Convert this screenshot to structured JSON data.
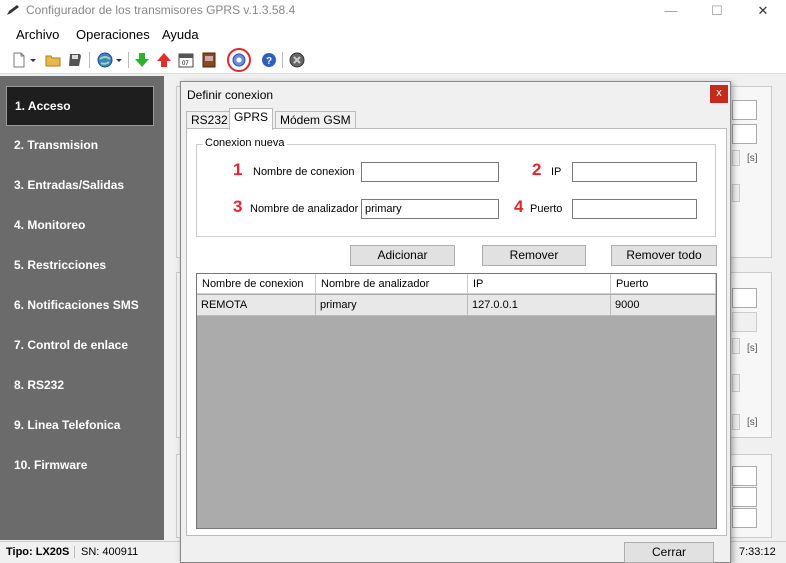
{
  "window": {
    "title": "Configurador de los transmisores GPRS v.1.3.58.4",
    "minimize": "—",
    "maximize": "☐",
    "close": "✕"
  },
  "menu": [
    "Archivo",
    "Operaciones",
    "Ayuda"
  ],
  "toolbar_icons": [
    "new-icon",
    "open-folder-icon",
    "save-icon",
    "connect-globe-icon",
    "download-icon",
    "upload-icon",
    "calendar-icon",
    "book-icon",
    "settings-gear-icon",
    "help-icon",
    "exit-icon"
  ],
  "sidebar": {
    "items": [
      {
        "label": "1. Acceso",
        "active": true
      },
      {
        "label": "2. Transmision"
      },
      {
        "label": "3. Entradas/Salidas"
      },
      {
        "label": "4. Monitoreo"
      },
      {
        "label": "5. Restricciones"
      },
      {
        "label": "6. Notificaciones SMS"
      },
      {
        "label": "7. Control de enlace"
      },
      {
        "label": "8. RS232"
      },
      {
        "label": "9. Linea Telefonica"
      },
      {
        "label": "10. Firmware"
      }
    ]
  },
  "background": {
    "unit1": "[s]",
    "unit2": "[s]",
    "unit3": "[s]"
  },
  "status": {
    "tipo": "Tipo: LX20S",
    "sn": "SN: 400911",
    "time": "7:33:12"
  },
  "dialog": {
    "title": "Definir conexion",
    "close": "x",
    "tabs": [
      "RS232",
      "GPRS",
      "Módem GSM"
    ],
    "active_tab": "GPRS",
    "group_title": "Conexion nueva",
    "fields": {
      "n1": "1",
      "nombre_conexion_label": "Nombre de conexion",
      "nombre_conexion_value": "",
      "n2": "2",
      "ip_label": "IP",
      "ip_value": "",
      "n3": "3",
      "nombre_analizador_label": "Nombre de analizador",
      "nombre_analizador_value": "primary",
      "n4": "4",
      "puerto_label": "Puerto",
      "puerto_value": ""
    },
    "buttons": {
      "add": "Adicionar",
      "remove": "Remover",
      "remove_all": "Remover todo",
      "close": "Cerrar"
    },
    "table": {
      "columns": [
        "Nombre de conexion",
        "Nombre de analizador",
        "IP",
        "Puerto"
      ],
      "rows": [
        [
          "REMOTA",
          "primary",
          "127.0.0.1",
          "9000"
        ]
      ]
    }
  },
  "colors": {
    "sidebar_bg": "#6b6b6b",
    "sidebar_active": "#1e1e1e",
    "dialog_close": "#c42b1c",
    "number_red": "#e3262d",
    "grid_bg": "#ababab"
  }
}
